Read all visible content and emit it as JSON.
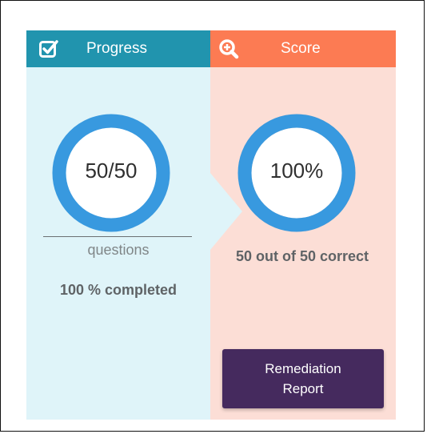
{
  "progress": {
    "title": "Progress",
    "icon": "checkbox-check-icon",
    "value_text": "50/50",
    "unit_label": "questions",
    "completed_text": "100 % completed",
    "answered": 50,
    "total": 50,
    "fraction": 1.0,
    "header_color": "#2194ae",
    "body_color": "#dff4f9"
  },
  "score": {
    "title": "Score",
    "icon": "magnify-plus-icon",
    "value_text": "100%",
    "correct_text": "50 out of 50 correct",
    "percent": 100,
    "header_color": "#fc7b53",
    "body_color": "#fcded6"
  },
  "ring_color": "#3899df",
  "remediation_button": {
    "label": "Remediation Report",
    "color": "#452a5e"
  }
}
